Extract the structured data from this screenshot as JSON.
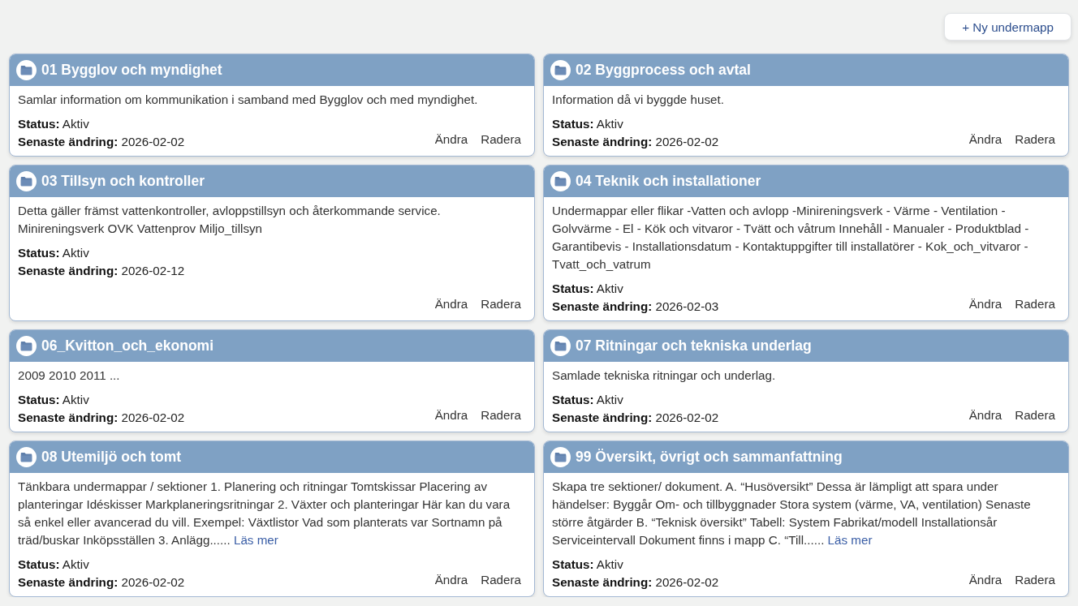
{
  "toolbar": {
    "new_button": "+ Ny undermapp"
  },
  "folders": [
    {
      "title": "01 Bygglov och myndighet",
      "description": "Samlar information om kommunikation i samband med Bygglov och med myndighet.",
      "status": "**Status:** Aktiv",
      "modified": "**Senaste ändring:** 2026-02-02",
      "actions": [
        "Ändra",
        "Radera"
      ]
    },
    {
      "title": "02 Byggprocess och avtal",
      "description": "Information då vi byggde huset.",
      "status": "**Status:** Aktiv",
      "modified": "**Senaste ändring:** 2026-02-02",
      "actions": [
        "Ändra",
        "Radera"
      ]
    },
    {
      "title": "03 Tillsyn och kontroller",
      "description": "Detta gäller främst vattenkontroller, avloppstillsyn och återkommande service. Minireningsverk OVK Vattenprov Miljo_tillsyn",
      "status": "**Status:** Aktiv",
      "modified": "**Senaste ändring:** 2026-02-12",
      "actions": [
        "Ändra",
        "Radera"
      ]
    },
    {
      "title": "04 Teknik och installationer",
      "description": "Undermappar eller flikar -Vatten och avlopp -Minireningsverk - Värme - Ventilation - Golvvärme - El - Kök och vitvaror - Tvätt och våtrum Innehåll - Manualer - Produktblad - Garantibevis - Installationsdatum - Kontaktuppgifter till installatörer - Kok_och_vitvaror - Tvatt_och_vatrum",
      "status": "**Status:** Aktiv",
      "modified": "**Senaste ändring:** 2026-02-03",
      "actions": [
        "Ändra",
        "Radera"
      ]
    },
    {
      "title": "06_Kvitton_och_ekonomi",
      "description": "2009 2010 2011 ...",
      "status": "**Status:** Aktiv",
      "modified": "**Senaste ändring:** 2026-02-02",
      "actions": [
        "Ändra",
        "Radera"
      ]
    },
    {
      "title": "07 Ritningar och tekniska underlag",
      "description": "Samlade tekniska ritningar och underlag.",
      "status": "**Status:** Aktiv",
      "modified": "**Senaste ändring:** 2026-02-02",
      "actions": [
        "Ändra",
        "Radera"
      ]
    },
    {
      "title": "08 Utemiljö och tomt",
      "description": "Tänkbara undermappar / sektioner 1. Planering och ritningar Tomtskissar Placering av planteringar Idéskisser Markplaneringsritningar 2. Växter och planteringar Här kan du vara så enkel eller avancerad du vill. Exempel: Växtlistor Vad som planterats var Sortnamn på träd/buskar Inköpsställen 3. Anlägg......",
      "read_more": "Läs mer",
      "status": "**Status:** Aktiv",
      "modified": "**Senaste ändring:** 2026-02-02",
      "actions": [
        "Ändra",
        "Radera"
      ]
    },
    {
      "title": "99 Översikt, övrigt och sammanfattning",
      "description": "Skapa tre sektioner/ dokument. A. “Husöversikt” Dessa är lämpligt att spara under händelser: Byggår Om- och tillbyggnader Stora system (värme, VA, ventilation) Senaste större åtgärder B. “Teknisk översikt” Tabell: System Fabrikat/modell Installationsår Serviceintervall Dokument finns i mapp C. “Till......",
      "read_more": "Läs mer",
      "status": "**Status:** Aktiv",
      "modified": "**Senaste ändring:** 2026-02-02",
      "actions": [
        "Ändra",
        "Radera"
      ]
    }
  ]
}
